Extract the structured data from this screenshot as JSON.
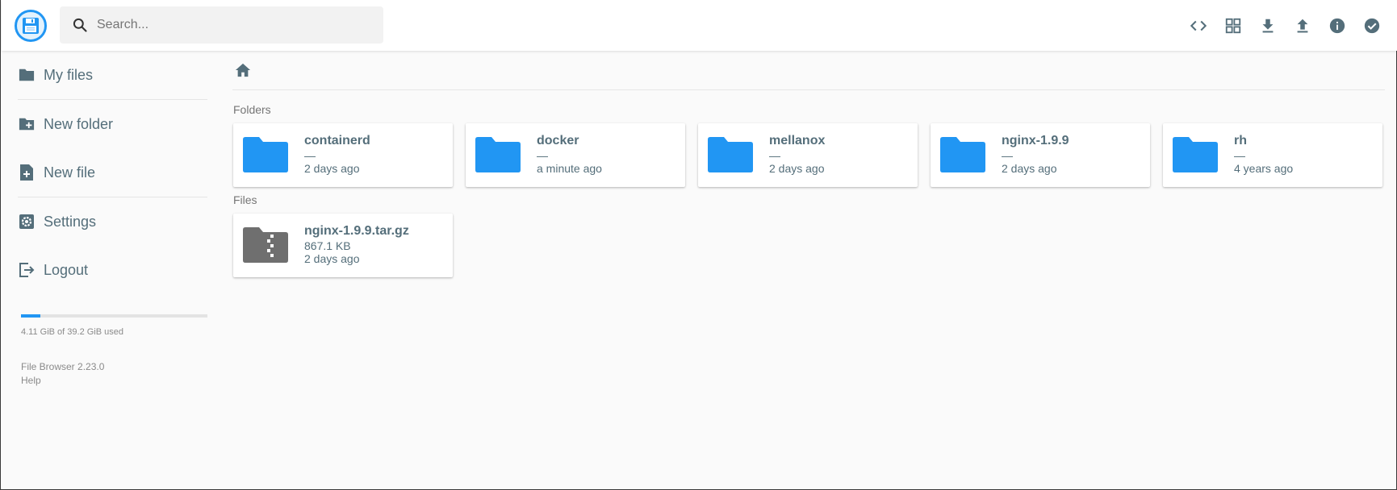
{
  "search": {
    "placeholder": "Search..."
  },
  "header": {
    "actions": [
      {
        "icon": "code-icon",
        "label": "Toggle code view"
      },
      {
        "icon": "grid-view-icon",
        "label": "Switch view"
      },
      {
        "icon": "download-icon",
        "label": "Download"
      },
      {
        "icon": "upload-icon",
        "label": "Upload"
      },
      {
        "icon": "info-icon",
        "label": "Info"
      },
      {
        "icon": "check-circle-icon",
        "label": "Select multiple"
      }
    ]
  },
  "sidebar": {
    "items": [
      {
        "label": "My files",
        "icon": "folder-icon"
      },
      {
        "label": "New folder",
        "icon": "create-new-folder-icon"
      },
      {
        "label": "New file",
        "icon": "note-add-icon"
      },
      {
        "label": "Settings",
        "icon": "settings-icon"
      },
      {
        "label": "Logout",
        "icon": "logout-icon"
      }
    ],
    "quota": {
      "text": "4.11 GiB of 39.2 GiB used",
      "fraction": 0.105
    },
    "version": "File Browser 2.23.0",
    "help": "Help"
  },
  "main": {
    "breadcrumb_icon": "home-icon",
    "folders_title": "Folders",
    "files_title": "Files",
    "folders": [
      {
        "name": "containerd",
        "size": "—",
        "modified": "2 days ago"
      },
      {
        "name": "docker",
        "size": "—",
        "modified": "a minute ago"
      },
      {
        "name": "mellanox",
        "size": "—",
        "modified": "2 days ago"
      },
      {
        "name": "nginx-1.9.9",
        "size": "—",
        "modified": "2 days ago"
      },
      {
        "name": "rh",
        "size": "—",
        "modified": "4 years ago"
      }
    ],
    "files": [
      {
        "name": "nginx-1.9.9.tar.gz",
        "size": "867.1 KB",
        "modified": "2 days ago",
        "icon": "archive-folder-icon"
      }
    ]
  },
  "colors": {
    "accent": "#2196f3",
    "text": "#546e7a",
    "archive": "#6f6f6f"
  }
}
